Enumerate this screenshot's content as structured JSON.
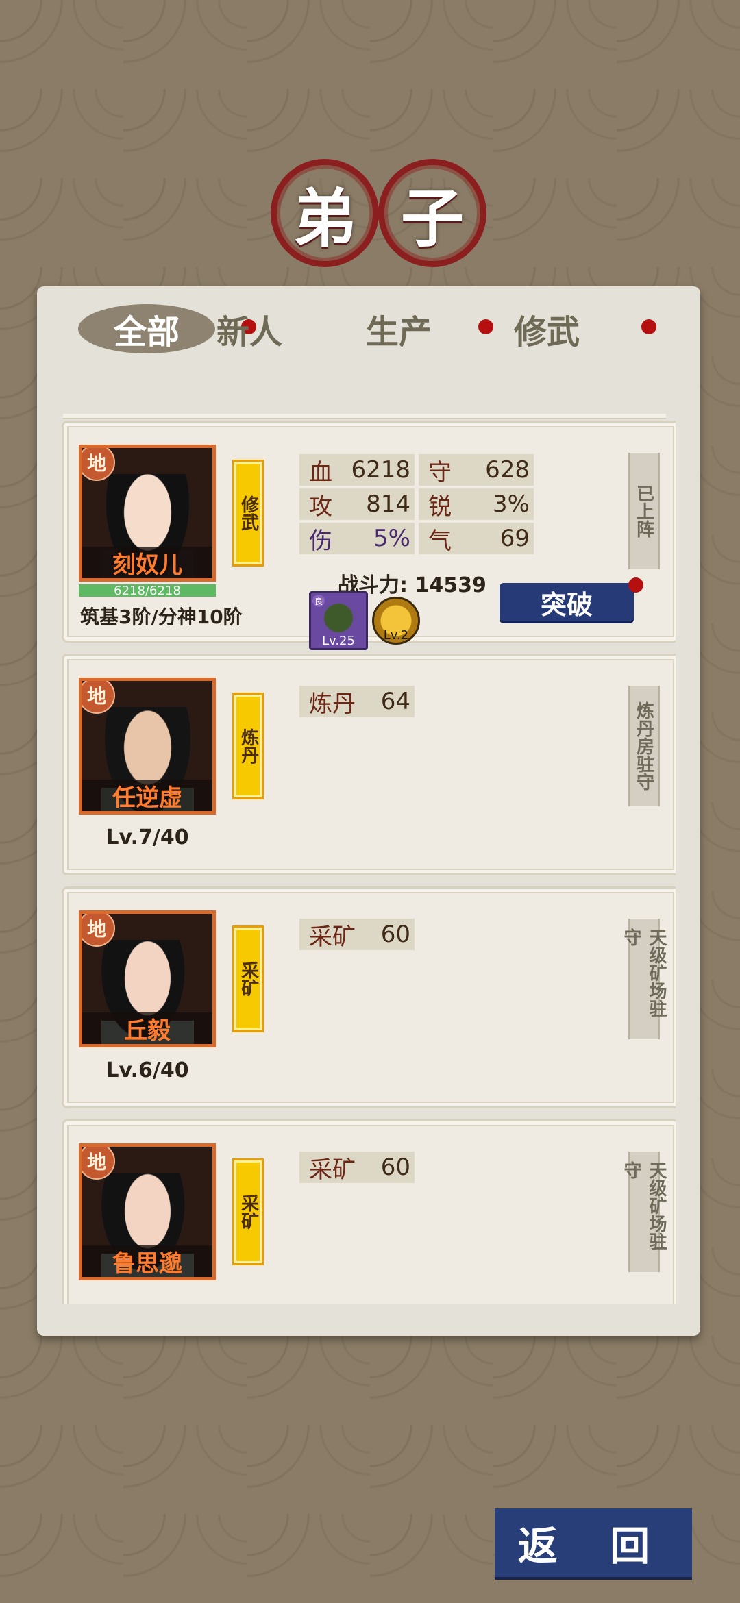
{
  "title": {
    "char1": "弟",
    "char2": "子"
  },
  "tabs": [
    {
      "label": "全部",
      "active": true,
      "badge": true
    },
    {
      "label": "新人",
      "active": false,
      "badge": false
    },
    {
      "label": "生产",
      "active": false,
      "badge": true
    },
    {
      "label": "修武",
      "active": false,
      "badge": true
    }
  ],
  "disciples": [
    {
      "name": "刻奴儿",
      "rank": "地",
      "role": "修武",
      "hp_text": "6218/6218",
      "hp_fraction": 1.0,
      "realm": "筑基3阶/分神10阶",
      "stats": [
        {
          "k": "血",
          "v": "6218"
        },
        {
          "k": "守",
          "v": "628"
        },
        {
          "k": "攻",
          "v": "814"
        },
        {
          "k": "锐",
          "v": "3%"
        },
        {
          "k": "伤",
          "v": "5%"
        },
        {
          "k": "气",
          "v": "69"
        }
      ],
      "power_label": "战斗力:",
      "power_value": "14539",
      "equip1_level": "Lv.25",
      "equip1_quality": "良",
      "equip2_level": "Lv.2",
      "status": "已上阵",
      "action": "突破"
    },
    {
      "name": "任逆虚",
      "rank": "地",
      "role": "炼丹",
      "skill": "炼丹",
      "skill_value": "64",
      "level": "Lv.7/40",
      "status": "炼丹房驻守"
    },
    {
      "name": "丘毅",
      "rank": "地",
      "role": "采矿",
      "skill": "采矿",
      "skill_value": "60",
      "level": "Lv.6/40",
      "status": "天级矿场驻守"
    },
    {
      "name": "鲁思邈",
      "rank": "地",
      "role": "采矿",
      "skill": "采矿",
      "skill_value": "60",
      "status": "天级矿场驻守"
    }
  ],
  "back_label": "返 回",
  "colors": {
    "accent": "#263a78",
    "badge": "#b60f0f",
    "name": "#ff7b2e",
    "role_tag": "#f7c900"
  }
}
